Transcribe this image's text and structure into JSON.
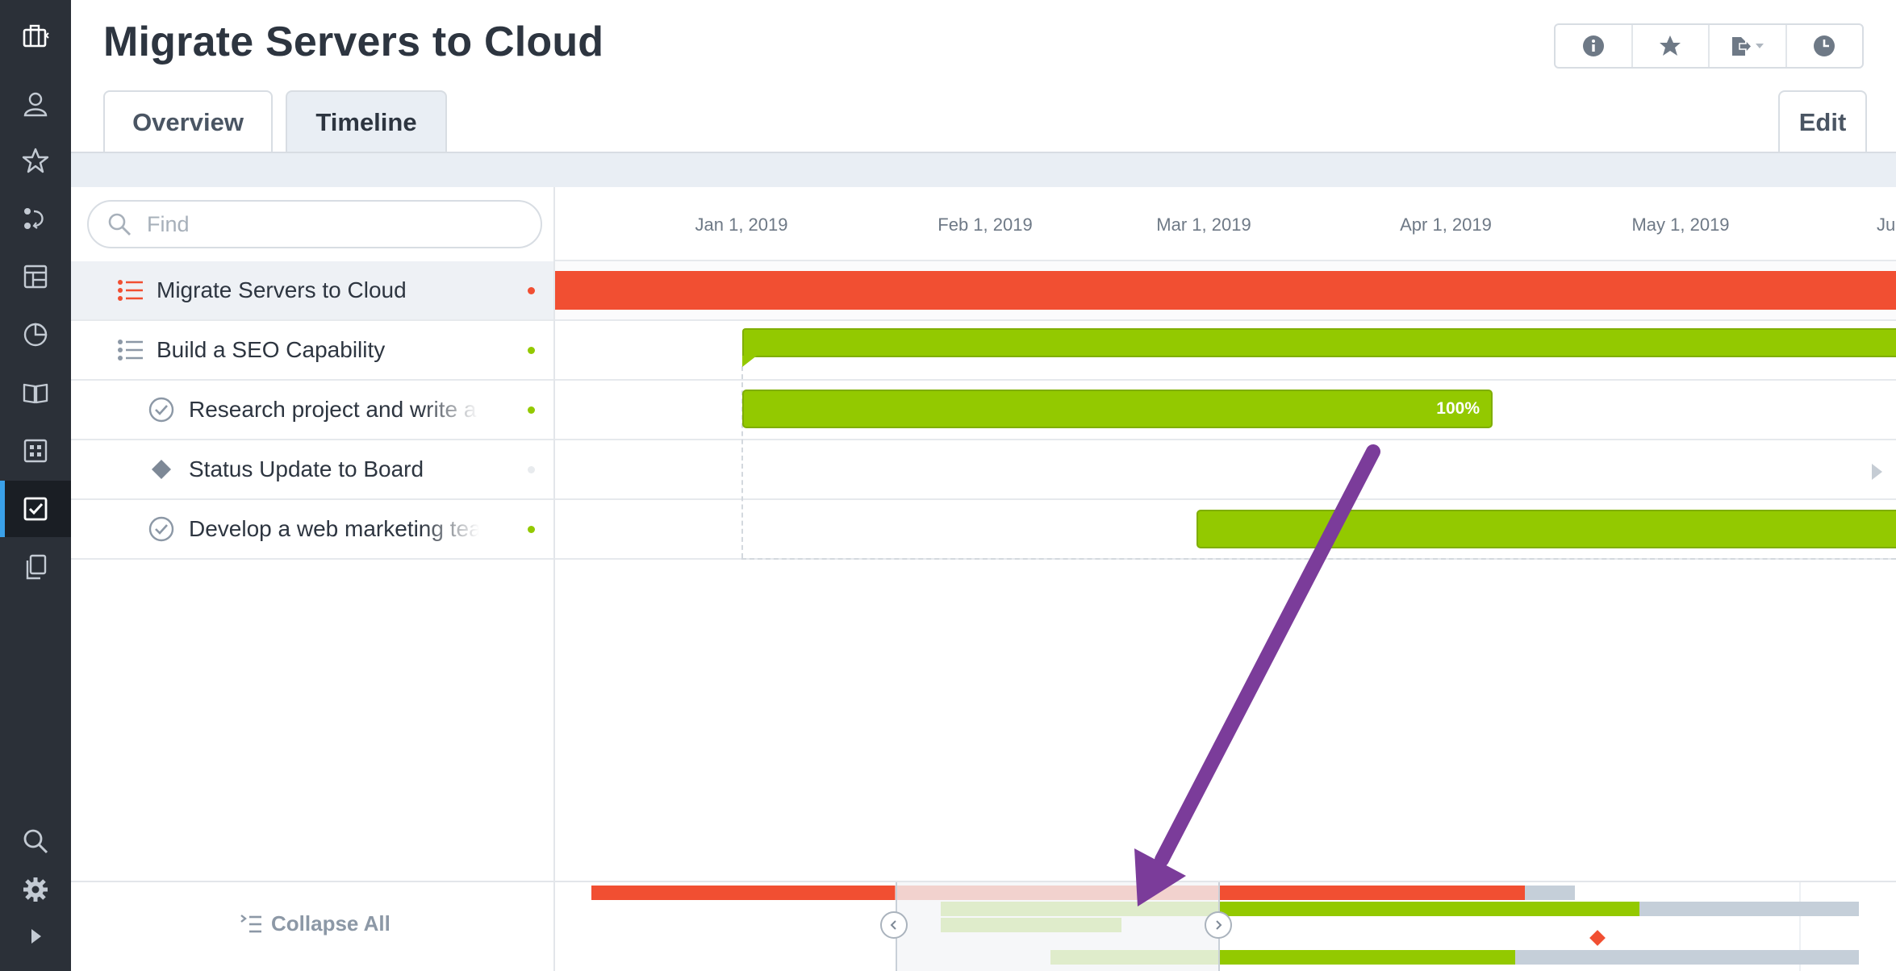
{
  "page": {
    "title": "Migrate Servers to Cloud"
  },
  "toolbar": {
    "icons": [
      "info-icon",
      "star-icon",
      "export-icon",
      "history-icon"
    ]
  },
  "tabs": {
    "overview": "Overview",
    "timeline": "Timeline",
    "active": "Timeline"
  },
  "edit_label": "Edit",
  "search": {
    "placeholder": "Find",
    "value": ""
  },
  "tasks": [
    {
      "name": "Migrate Servers to Cloud",
      "type": "project",
      "status_color": "#f14f32",
      "selected": true
    },
    {
      "name": "Build a SEO Capability",
      "type": "project",
      "status_color": "#93c900",
      "selected": false
    },
    {
      "name": "Research project and write a r",
      "type": "task",
      "status_color": "#93c900",
      "selected": false
    },
    {
      "name": "Status Update to Board",
      "type": "milestone",
      "status_color": "#e8ebee",
      "selected": false
    },
    {
      "name": "Develop a web marketing tean",
      "type": "task",
      "status_color": "#93c900",
      "selected": false
    }
  ],
  "collapse_all_label": "Collapse All",
  "timeline": {
    "dates": [
      "Jan 1, 2019",
      "Feb 1, 2019",
      "Mar 1, 2019",
      "Apr 1, 2019",
      "May 1, 2019",
      "Ju"
    ],
    "research_progress_label": "100%"
  },
  "colors": {
    "red": "#f14f32",
    "green": "#93c900",
    "accent": "#3aa0e8",
    "rail": "#2b3038",
    "annotation_arrow": "#7b3c9a"
  },
  "nav_icons": [
    "portfolio-icon",
    "user-icon",
    "favorites-star-icon",
    "workflow-icon",
    "dashboard-icon",
    "reports-pie-icon",
    "library-book-icon",
    "apps-grid-icon",
    "tasks-checkbox-icon",
    "documents-icon",
    "search-icon",
    "settings-gear-icon",
    "expand-arrow-icon"
  ]
}
